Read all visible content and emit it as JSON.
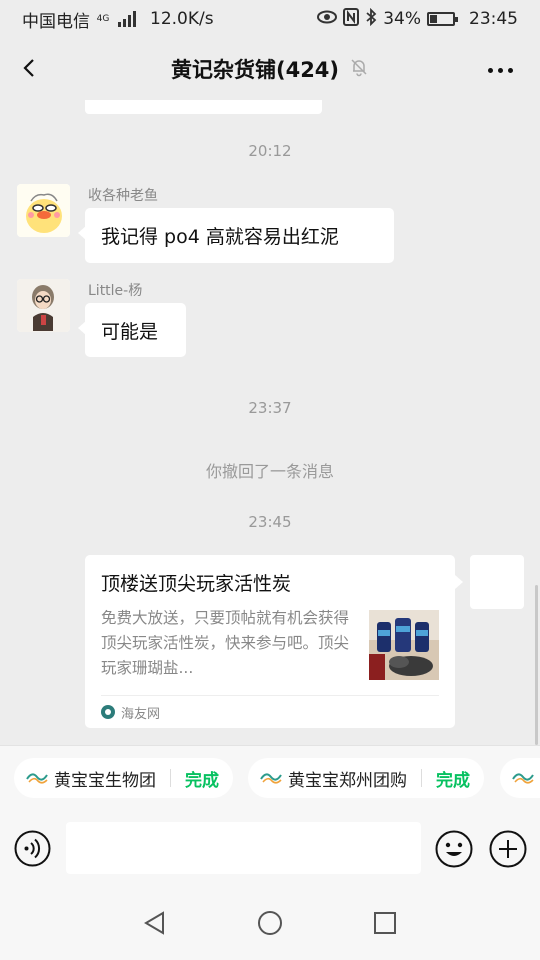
{
  "status_bar": {
    "carrier": "中国电信",
    "net_tag": "4G",
    "speed": "12.0K/s",
    "battery": "34%",
    "battery_level": 0.34,
    "time": "23:45"
  },
  "header": {
    "title": "黄记杂货铺(424)"
  },
  "messages": {
    "ts1": "20:12",
    "m1_sender": "收各种老鱼",
    "m1_text": "我记得 po4 高就容易出红泥",
    "m2_sender": "Little-杨",
    "m2_text": "可能是",
    "ts2": "23:37",
    "recall": "你撤回了一条消息",
    "ts3": "23:45"
  },
  "link_card": {
    "title": "顶楼送顶尖玩家活性炭",
    "description": "免费大放送，只要顶帖就有机会获得顶尖玩家活性炭，快来参与吧。顶尖玩家珊瑚盐...",
    "source": "海友网"
  },
  "quick_replies": [
    {
      "name": "黄宝宝生物团",
      "action": "完成"
    },
    {
      "name": "黄宝宝郑州团购",
      "action": "完成"
    }
  ],
  "input": {
    "value": "",
    "placeholder": ""
  },
  "colors": {
    "background": "#ededed",
    "accent_green": "#07c160",
    "bubble": "#ffffff"
  }
}
